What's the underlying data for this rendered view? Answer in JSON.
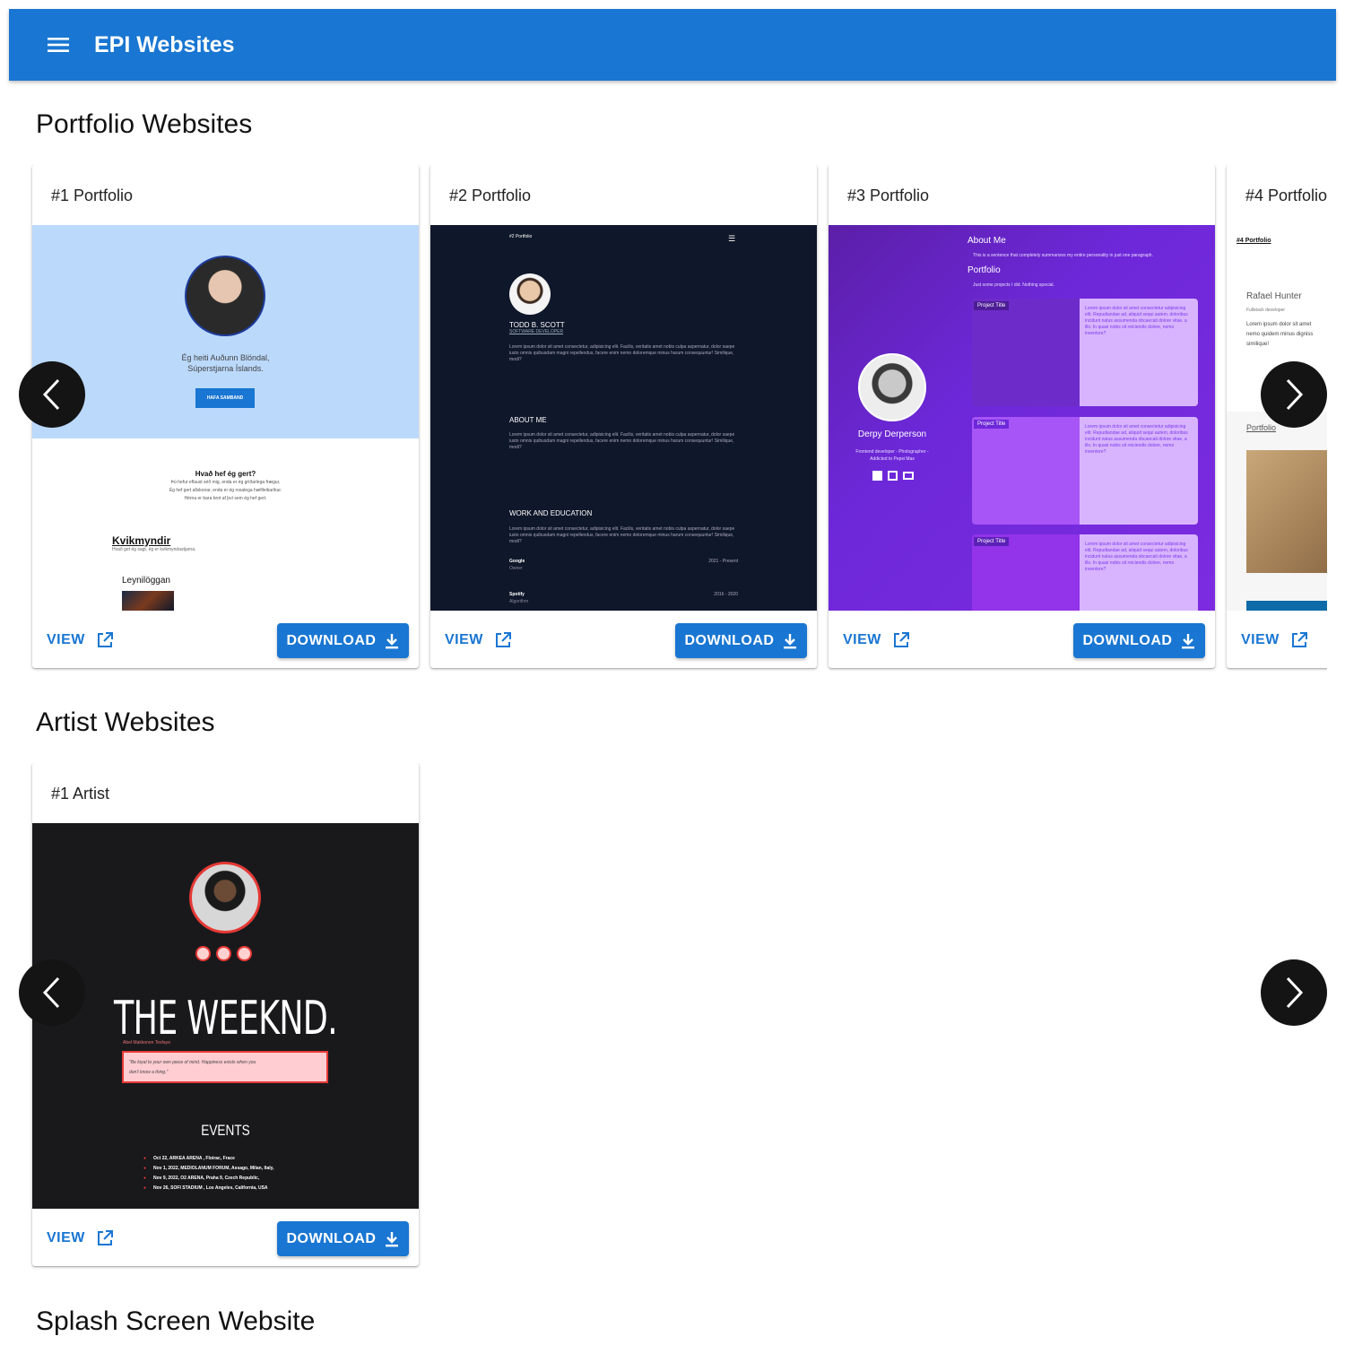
{
  "header": {
    "title": "EPI Websites",
    "menu_icon": "hamburger-menu-icon"
  },
  "sections": {
    "portfolio": {
      "title": "Portfolio Websites",
      "cards": [
        {
          "title": "#1 Portfolio",
          "preview": {
            "intro_line1": "Ég heiti Auðunn Blöndal,",
            "intro_line2": "Súperstjarna Íslands.",
            "contact_button": "HAFA SAMBAND",
            "section_heading": "Hvað hef ég gert?",
            "section_line1": "Þú hefur eflaust séð mig, enda er ég gríðarlega frægur,",
            "section_line2": "Ég hef gert allskonar, enda er ég rosalega hæfileikaríkur.",
            "section_line3": "Hérna er bara brot af því sem ég hef gert.",
            "movies_heading": "Kvikmyndir",
            "movies_sub": "Hvað get ég sagt, ég er kvikmyndastjarna.",
            "movie_item": "Leynilöggan"
          }
        },
        {
          "title": "#2 Portfolio",
          "preview": {
            "brand": "#2 Portfolio",
            "name": "TODD B. SCOTT",
            "role": "SOFTWARE DEVELOPER",
            "lorem": "Lorem ipsum dolor sit amet consectetur, adipisicing elit. Facilis, veritatis amet nobis culpa aspernatur, dolor saepe iusto omnis quibusdam magni repellendus, facere enim nemo doloremque minus harum consequuntur! Similique, modi?",
            "about_heading": "ABOUT ME",
            "work_heading": "WORK AND EDUCATION",
            "job1_company": "Google",
            "job1_role": "Owner",
            "job1_period": "2021 - Present",
            "job2_company": "Spotify",
            "job2_role": "Algorithm",
            "job2_period": "2016 - 2020"
          }
        },
        {
          "title": "#3 Portfolio",
          "preview": {
            "about_heading": "About Me",
            "about_text": "This is a sentence that completely summarizes my entire personality in just one paragraph.",
            "portfolio_heading": "Portfolio",
            "portfolio_text": "Just some projects I did. Nothing special.",
            "name": "Derpy Derperson",
            "bio_line1": "Frontend developer - Photographer -",
            "bio_line2": "Addicted to Pepsi Max",
            "project_title": "Project Title",
            "project_text": "Lorem ipsum dolor sit amet consectetur adipisicing elit. Repudiandae ad, aliquid sequi autem, doloribus incidunt natus assumenda obcaecati dolore vitae, a illo. In quasi nobis sit reiciendis dolore, nemo inventore?"
          }
        },
        {
          "title": "#4 Portfolio",
          "preview": {
            "brand": "#4 Portfolio",
            "name": "Rafael Hunter",
            "role": "Fullstack developer",
            "lorem_line1": "Lorem ipsum dolor sit amet",
            "lorem_line2": "nemo quidem minus digniss",
            "lorem_line3": "similique!",
            "portfolio_link": "Portfolio"
          }
        }
      ]
    },
    "artist": {
      "title": "Artist Websites",
      "cards": [
        {
          "title": "#1 Artist",
          "preview": {
            "artist": "THE WEEKND.",
            "real_name": "Abel Makkonen Tesfaye",
            "quote_line1": "\"Be loyal to your own piece of mind. Happiness exists when you",
            "quote_line2": "don't know a thing.\"",
            "events_heading": "EVENTS",
            "events": [
              "Oct 22, ARKEA ARENA , Floirac, Frace",
              "Nov 1, 2022, MEDIOLANUM FORUM, Assago, Milan, Italy,",
              "Nov 9, 2022, O2 ARENA, Praha 9, Czech Republic,",
              "Nov 26, SOFI STADIUM , Los Angeles, California, USA"
            ]
          }
        }
      ]
    },
    "splash": {
      "title": "Splash Screen Website"
    }
  },
  "actions": {
    "view_label": "VIEW",
    "download_label": "DOWNLOAD"
  },
  "icons": {
    "open": "open-in-new-icon",
    "download": "download-icon",
    "prev": "chevron-left-icon",
    "next": "chevron-right-icon"
  },
  "colors": {
    "primary": "#1976d2",
    "arrow_bg": "#141414",
    "artist_accent": "#e53935"
  }
}
